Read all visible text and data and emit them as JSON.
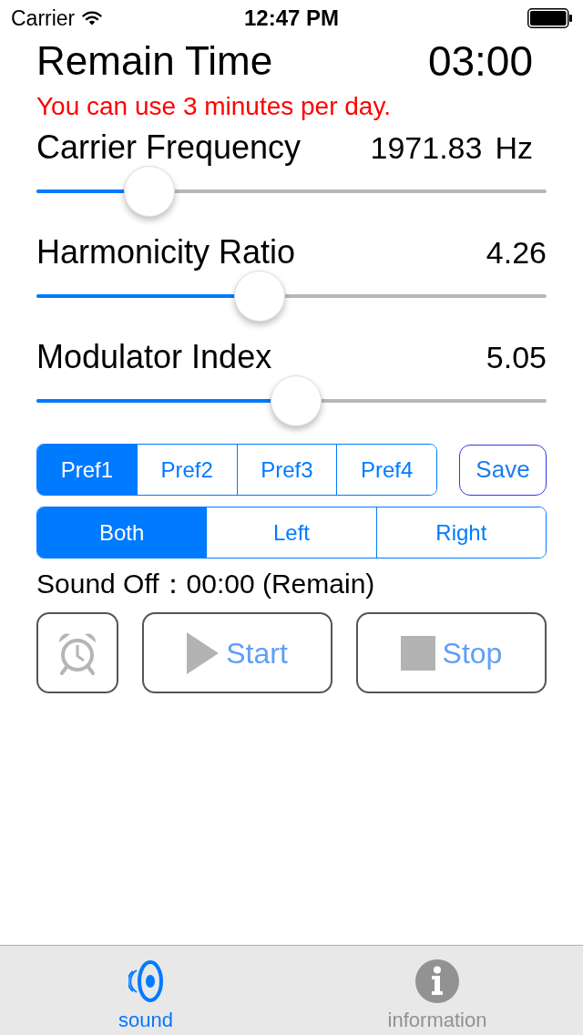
{
  "status_bar": {
    "carrier": "Carrier",
    "time": "12:47 PM"
  },
  "remain": {
    "label": "Remain Time",
    "value": "03:00",
    "notice": "You can use 3 minutes per day."
  },
  "sliders": [
    {
      "label": "Carrier Frequency",
      "reading": "1971.83",
      "unit": "Hz",
      "level": 0.19
    },
    {
      "label": "Harmonicity Ratio",
      "reading": "4.26",
      "level": 0.43
    },
    {
      "label": "Modulator Index",
      "reading": "5.05",
      "level": 0.51
    }
  ],
  "presets": [
    {
      "label": "Pref1",
      "selected": true
    },
    {
      "label": "Pref2",
      "selected": false
    },
    {
      "label": "Pref3",
      "selected": false
    },
    {
      "label": "Pref4",
      "selected": false
    }
  ],
  "save_button": "Save",
  "channels": [
    {
      "label": "Both",
      "selected": true
    },
    {
      "label": "Left",
      "selected": false
    },
    {
      "label": "Right",
      "selected": false
    }
  ],
  "sound_off": "Sound Off：00:00 (Remain)",
  "buttons": [
    {
      "kind": "alarm"
    },
    {
      "kind": "start",
      "label": "Start"
    },
    {
      "kind": "stop",
      "label": "Stop"
    }
  ],
  "tabs": [
    {
      "kind": "sound",
      "label": "sound",
      "selected": true
    },
    {
      "kind": "info",
      "label": "information",
      "selected": false
    }
  ]
}
